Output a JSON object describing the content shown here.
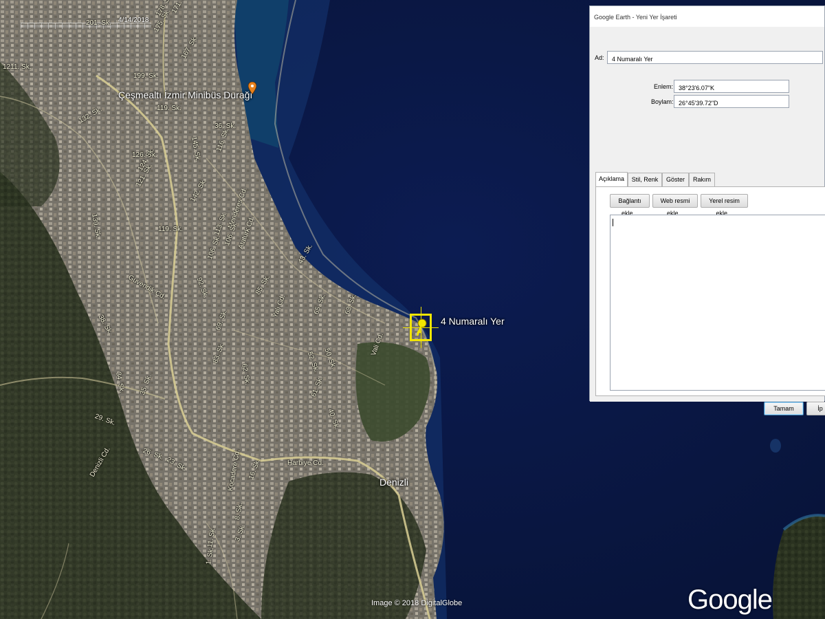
{
  "map": {
    "timeline_date": "4/14/2018",
    "placemark_label": "4 Numaralı Yer",
    "image_credit": "Image © 2018 DigitalGlobe",
    "logo": "Google Earth",
    "place_labels": [
      {
        "id": "bus-stop",
        "text": "Çeşmealtı İzmir Minibüs Durağı"
      },
      {
        "id": "denizli",
        "text": "Denizli"
      }
    ],
    "road_labels": [
      "201. Sk.",
      "178. Sk.",
      "175. Sk.",
      "171. Sk.",
      "167. Sk.",
      "1211. Sk.",
      "199. Sk.",
      "119. Sk.",
      "132. Sk.",
      "36. Sk.",
      "126. Sk.",
      "124. Sk.",
      "121. Sk.",
      "145. Sk.",
      "116. Sk.",
      "119. Sk.",
      "139. Sk.",
      "142. Sk.",
      "Menderes Cd.",
      "113. Sk.",
      "106. Sk.",
      "Atatürk Cd.",
      "92. Sk.",
      "Güvendik Cd.",
      "38. Sk.",
      "85. Sk.",
      "43. Sk.",
      "65. Sk.",
      "63. Sk.",
      "69. Sk.",
      "83. Sk.",
      "62. Sk.",
      "52. Sk.",
      "50. Sk.",
      "Vali Cd.",
      "61. Sk.",
      "40. Sk.",
      "35. Sk.",
      "29. Sk.",
      "34. Sk.",
      "26. Sk.",
      "23. Sk.",
      "Denizli Cd.",
      "Harbiye Cd.",
      "16. Sk.",
      "Kocadere Cd.",
      "8. Sk.",
      "3. Sk.",
      "11. Sk.",
      "1. Sk.",
      "106. Sk.",
      "Yalı Cd."
    ]
  },
  "dialog": {
    "title": "Google Earth - Yeni Yer İşareti",
    "name_label": "Ad:",
    "name_value": "4 Numaralı Yer",
    "lat_label": "Enlem:",
    "lat_value": "38°23'6.07\"K",
    "lon_label": "Boylam:",
    "lon_value": "26°45'39.72\"D",
    "tabs": [
      {
        "label": "Açıklama",
        "active": true
      },
      {
        "label": "Stil, Renk",
        "active": false
      },
      {
        "label": "Göster",
        "active": false
      },
      {
        "label": "Rakım",
        "active": false
      }
    ],
    "buttons": {
      "add_link": "Bağlantı ekle...",
      "add_web_image": "Web resmi ekle...",
      "add_local_image": "Yerel resim ekle...",
      "ok": "Tamam",
      "cancel": "İp"
    }
  },
  "colors": {
    "sea": "#0a1a4a",
    "land": "#5e5a44",
    "highlight": "#f3e600"
  }
}
